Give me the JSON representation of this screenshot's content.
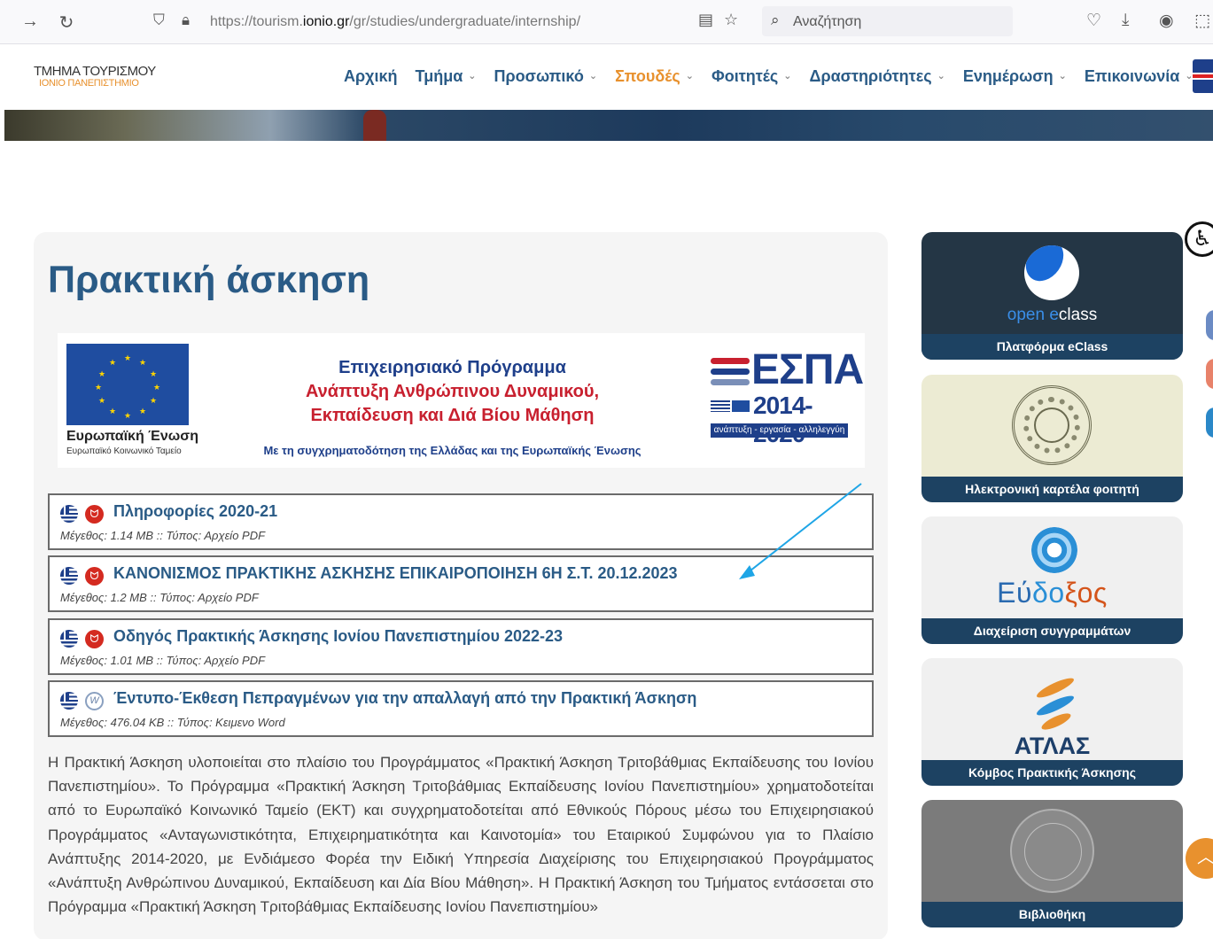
{
  "browser": {
    "url_prefix": "https://tourism.",
    "url_domain": "ionio.gr",
    "url_path": "/gr/studies/undergraduate/internship/",
    "search_placeholder": "Αναζήτηση"
  },
  "site": {
    "logo_line1": "ΤΜΗΜΑ ΤΟΥΡΙΣΜΟΥ",
    "logo_line2": "ΙΟΝΙΟ ΠΑΝΕΠΙΣΤΗΜΙΟ",
    "nav": [
      {
        "label": "Αρχική"
      },
      {
        "label": "Τμήμα"
      },
      {
        "label": "Προσωπικό"
      },
      {
        "label": "Σπουδές"
      },
      {
        "label": "Φοιτητές"
      },
      {
        "label": "Δραστηριότητες"
      },
      {
        "label": "Ενημέρωση"
      },
      {
        "label": "Επικοινωνία"
      }
    ]
  },
  "main": {
    "title": "Πρακτική άσκηση",
    "espa": {
      "eu_name": "Ευρωπαϊκή Ένωση",
      "eu_fund": "Ευρωπαϊκό Κοινωνικό Ταμείο",
      "program_line1": "Επιχειρησιακό Πρόγραμμα",
      "program_line2": "Ανάπτυξη Ανθρώπινου Δυναμικού,",
      "program_line3": "Εκπαίδευση και Διά Βίου Μάθηση",
      "cofunding": "Με τη συγχρηματοδότηση της Ελλάδας και της Ευρωπαϊκής Ένωσης",
      "logo_word": "ΕΣΠΑ",
      "logo_years": "2014-2020",
      "logo_tagline": "ανάπτυξη - εργασία - αλληλεγγύη"
    },
    "files": [
      {
        "title": "Πληροφορίες 2020-21",
        "meta": "Μέγεθος: 1.14 MB :: Τύπος: Αρχείο PDF",
        "icon": "pdf-icon"
      },
      {
        "title": "ΚΑΝΟΝΙΣΜΟΣ ΠΡΑΚΤΙΚΗΣ ΑΣΚΗΣΗΣ ΕΠΙΚΑΙΡΟΠΟΙΗΣΗ 6Η Σ.Τ. 20.12.2023",
        "meta": "Μέγεθος: 1.2 MB :: Τύπος: Αρχείο PDF",
        "icon": "pdf-icon"
      },
      {
        "title": "Οδηγός Πρακτικής Άσκησης Ιονίου Πανεπιστημίου 2022-23",
        "meta": "Μέγεθος: 1.01 MB :: Τύπος: Αρχείο PDF",
        "icon": "pdf-icon"
      },
      {
        "title": "Έντυπο-Έκθεση Πεπραγμένων για την απαλλαγή από την Πρακτική Άσκηση",
        "meta": "Μέγεθος: 476.04 KB :: Τύπος: Κειμενο Word",
        "icon": "word-icon"
      }
    ],
    "body": "Η Πρακτική Άσκηση υλοποιείται στο πλαίσιο του Προγράμματος «Πρακτική Άσκηση Τριτοβάθμιας Εκπαίδευσης του Ιονίου Πανεπιστημίου». Το Πρόγραμμα «Πρακτική Άσκηση Τριτοβάθμιας Εκπαίδευσης Ιονίου Πανεπιστημίου» χρηματοδοτείται από το Ευρωπαϊκό Κοινωνικό Ταμείο (ΕΚΤ) και συγχρηματοδοτείται από Εθνικούς Πόρους μέσω του Επιχειρησιακού Προγράμματος «Ανταγωνιστικότητα, Επιχειρηματικότητα και Καινοτομία» του Εταιρικού Συμφώνου για το Πλαίσιο Ανάπτυξης 2014-2020, με Ενδιάμεσο Φορέα την Ειδική Υπηρεσία Διαχείρισης του Επιχειρησιακού Προγράμματος «Ανάπτυξη Ανθρώπινου Δυναμικού, Εκπαίδευση και Δία Βίου Μάθηση». Η Πρακτική Άσκηση του Τμήματος εντάσσεται στο Πρόγραμμα «Πρακτική Άσκηση Τριτοβάθμιας Εκπαίδευσης Ιονίου Πανεπιστημίου»"
  },
  "sidebar": {
    "eclass_word_a": "open ",
    "eclass_word_b": "e",
    "eclass_word_c": "class",
    "eclass_label": "Πλατφόρμα eClass",
    "student_label": "Ηλεκτρονική καρτέλα φοιτητή",
    "eudoxus_word_a": "Εύ",
    "eudoxus_word_b": "δο",
    "eudoxus_word_c": "ξος",
    "eudoxus_label": "Διαχείριση συγγραμμάτων",
    "atlas_word": "ΑΤΛΑΣ",
    "atlas_label": "Κόμβος Πρακτικής Άσκησης",
    "library_label": "Βιβλιοθήκη"
  },
  "colors": {
    "nav_blue": "#2a5b86",
    "active_orange": "#e8912e",
    "sidebar_label_bg": "#1d4262",
    "annotation_arrow": "#1ea5e6"
  }
}
